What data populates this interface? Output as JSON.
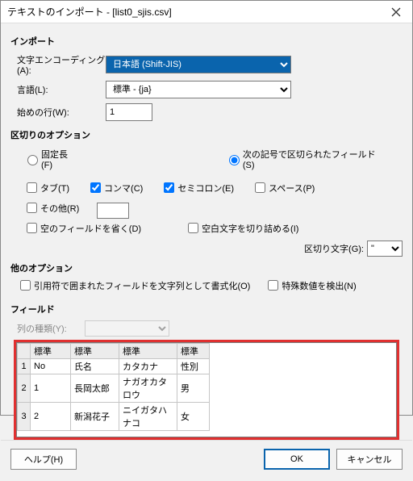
{
  "window": {
    "title": "テキストのインポート - [list0_sjis.csv]"
  },
  "import": {
    "heading": "インポート",
    "encoding_label": "文字エンコーディング(A):",
    "encoding_value": "日本語 (Shift-JIS)",
    "language_label": "言語(L):",
    "language_value": "標準 - {ja}",
    "startrow_label": "始めの行(W):",
    "startrow_value": "1"
  },
  "delim": {
    "heading": "区切りのオプション",
    "fixed_label": "固定長(F)",
    "delimited_label": "次の記号で区切られたフィールド(S)",
    "tab_label": "タブ(T)",
    "comma_label": "コンマ(C)",
    "semicolon_label": "セミコロン(E)",
    "space_label": "スペース(P)",
    "other_label": "その他(R)",
    "merge_label": "空のフィールドを省く(D)",
    "trim_label": "空白文字を切り詰める(I)",
    "quote_label": "区切り文字(G):",
    "quote_value": "\""
  },
  "other": {
    "heading": "他のオプション",
    "quoted_as_text_label": "引用符で囲まれたフィールドを文字列として書式化(O)",
    "detect_special_label": "特殊数値を検出(N)"
  },
  "fields": {
    "heading": "フィールド",
    "coltype_label": "列の種類(Y):",
    "col_header": "標準",
    "rows": [
      {
        "n": "1",
        "a": "No",
        "b": "氏名",
        "c": "カタカナ",
        "d": "性別"
      },
      {
        "n": "2",
        "a": "1",
        "b": "長岡太郎",
        "c": "ナガオカタロウ",
        "d": "男"
      },
      {
        "n": "3",
        "a": "2",
        "b": "新潟花子",
        "c": "ニイガタハナコ",
        "d": "女"
      }
    ]
  },
  "buttons": {
    "help": "ヘルプ(H)",
    "ok": "OK",
    "cancel": "キャンセル"
  }
}
